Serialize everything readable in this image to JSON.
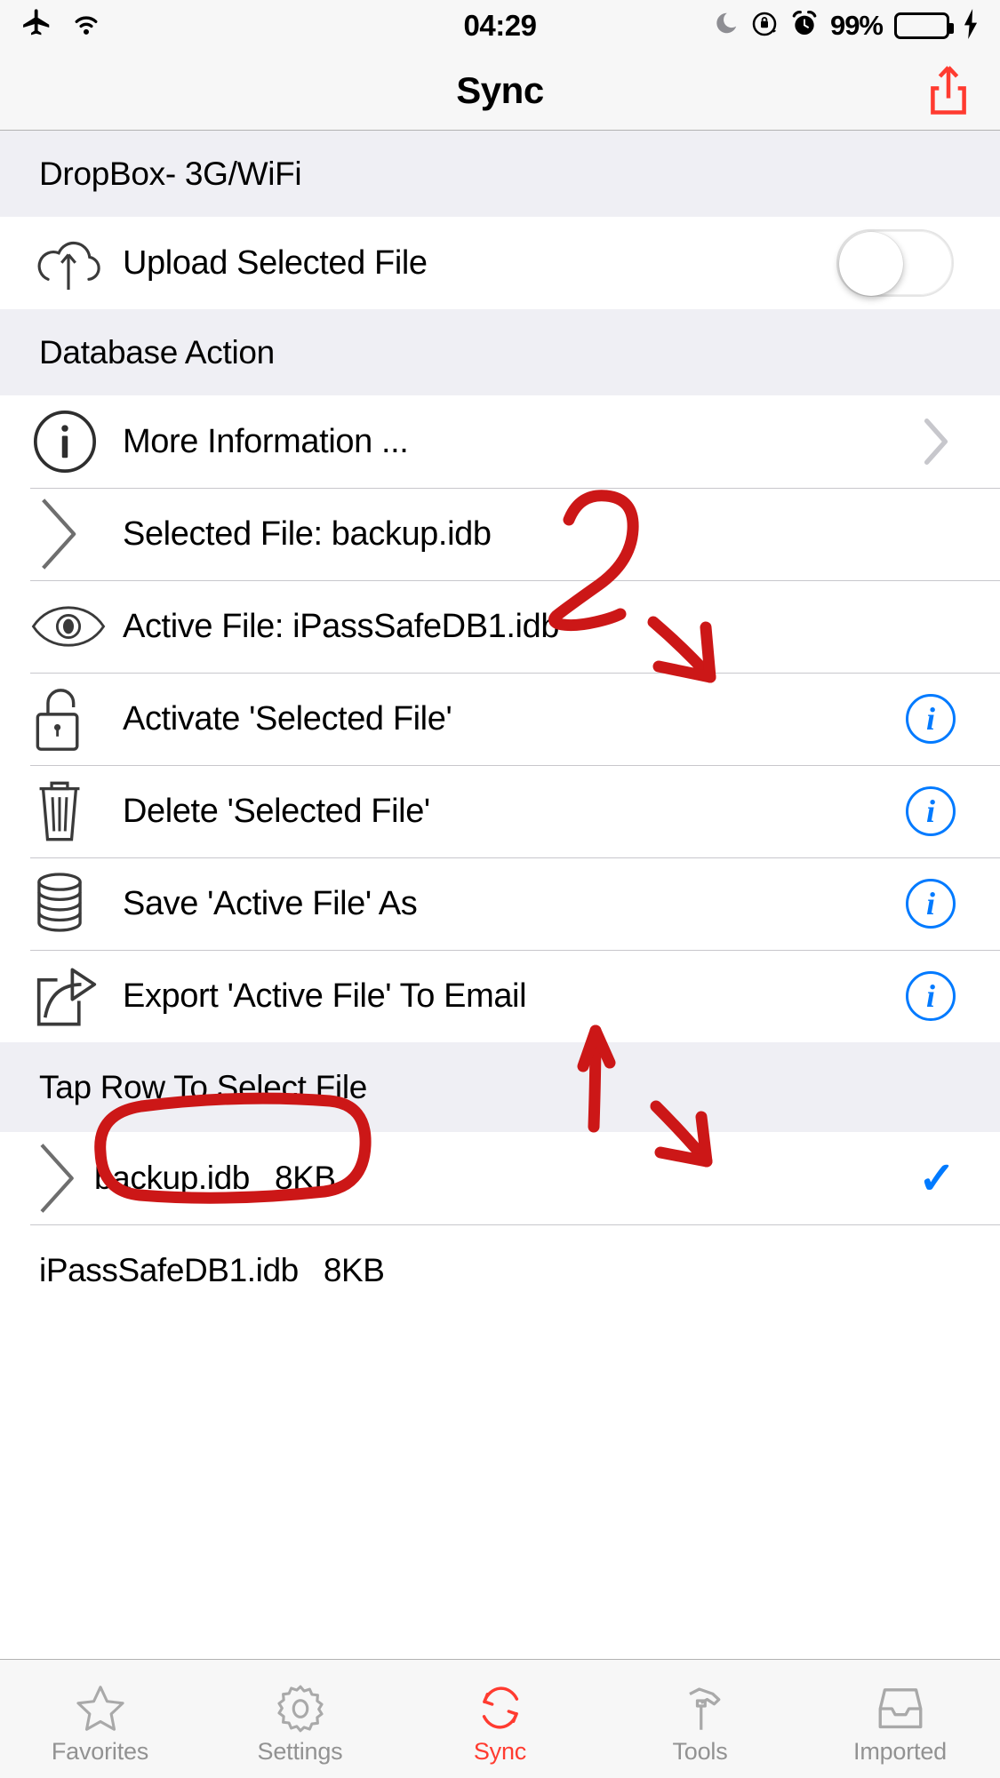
{
  "status_bar": {
    "airplane_icon": "airplane-mode-icon",
    "wifi_icon": "wifi-icon",
    "time": "04:29",
    "dnd_icon": "do-not-disturb-moon-icon",
    "rotation_lock_icon": "rotation-lock-icon",
    "alarm_icon": "alarm-clock-icon",
    "battery_percent": "99%",
    "battery_icon": "battery-icon",
    "charging_icon": "charging-bolt-icon",
    "battery_color": "#4cd964"
  },
  "navbar": {
    "title": "Sync",
    "action_icon": "share-export-icon",
    "action_color": "#ff3b30"
  },
  "sections": [
    {
      "header": "DropBox- 3G/WiFi",
      "rows": [
        {
          "icon": "cloud-upload-icon",
          "label": "Upload Selected File",
          "accessory": "toggle",
          "toggle_on": false
        }
      ]
    },
    {
      "header": "Database Action",
      "rows": [
        {
          "icon": "info-circle-icon",
          "label": "More Information ...",
          "accessory": "chevron"
        },
        {
          "icon": "chevron-right-icon",
          "label": "Selected File: backup.idb",
          "accessory": "none"
        },
        {
          "icon": "eye-icon",
          "label": "Active File: iPassSafeDB1.idb",
          "accessory": "none"
        },
        {
          "icon": "unlock-padlock-icon",
          "label": "Activate 'Selected File'",
          "accessory": "info"
        },
        {
          "icon": "trash-icon",
          "label": "Delete 'Selected File'",
          "accessory": "info"
        },
        {
          "icon": "database-stack-icon",
          "label": "Save 'Active File' As",
          "accessory": "info"
        },
        {
          "icon": "export-share-icon",
          "label": "Export 'Active File' To Email",
          "accessory": "info"
        }
      ]
    },
    {
      "header": "Tap Row To Select File",
      "files": [
        {
          "icon": "chevron-right-icon",
          "name": "backup.idb",
          "size": "8KB",
          "selected": true,
          "highlighted": true
        },
        {
          "icon": "none",
          "name": "iPassSafeDB1.idb",
          "size": "8KB",
          "selected": false,
          "highlighted": false
        }
      ]
    }
  ],
  "tabbar": {
    "items": [
      {
        "icon": "star-icon",
        "label": "Favorites",
        "active": false
      },
      {
        "icon": "gear-icon",
        "label": "Settings",
        "active": false
      },
      {
        "icon": "sync-refresh-icon",
        "label": "Sync",
        "active": true
      },
      {
        "icon": "hammer-icon",
        "label": "Tools",
        "active": false
      },
      {
        "icon": "inbox-tray-icon",
        "label": "Imported",
        "active": false
      }
    ],
    "active_color": "#ff3b30",
    "inactive_color": "#929292"
  },
  "annotations": {
    "color": "#cc1717",
    "marks": [
      {
        "name": "handwritten-number-2",
        "text": "2"
      },
      {
        "name": "arrow-to-info-button"
      },
      {
        "name": "arrow-up-to-section-header"
      },
      {
        "name": "arrow-down-to-checkmark"
      },
      {
        "name": "ellipse-around-backup-file"
      }
    ]
  },
  "colors": {
    "tint_blue": "#007aff",
    "accent_red": "#ff3b30",
    "section_bg": "#efeff4",
    "separator": "#c8c7cc"
  }
}
